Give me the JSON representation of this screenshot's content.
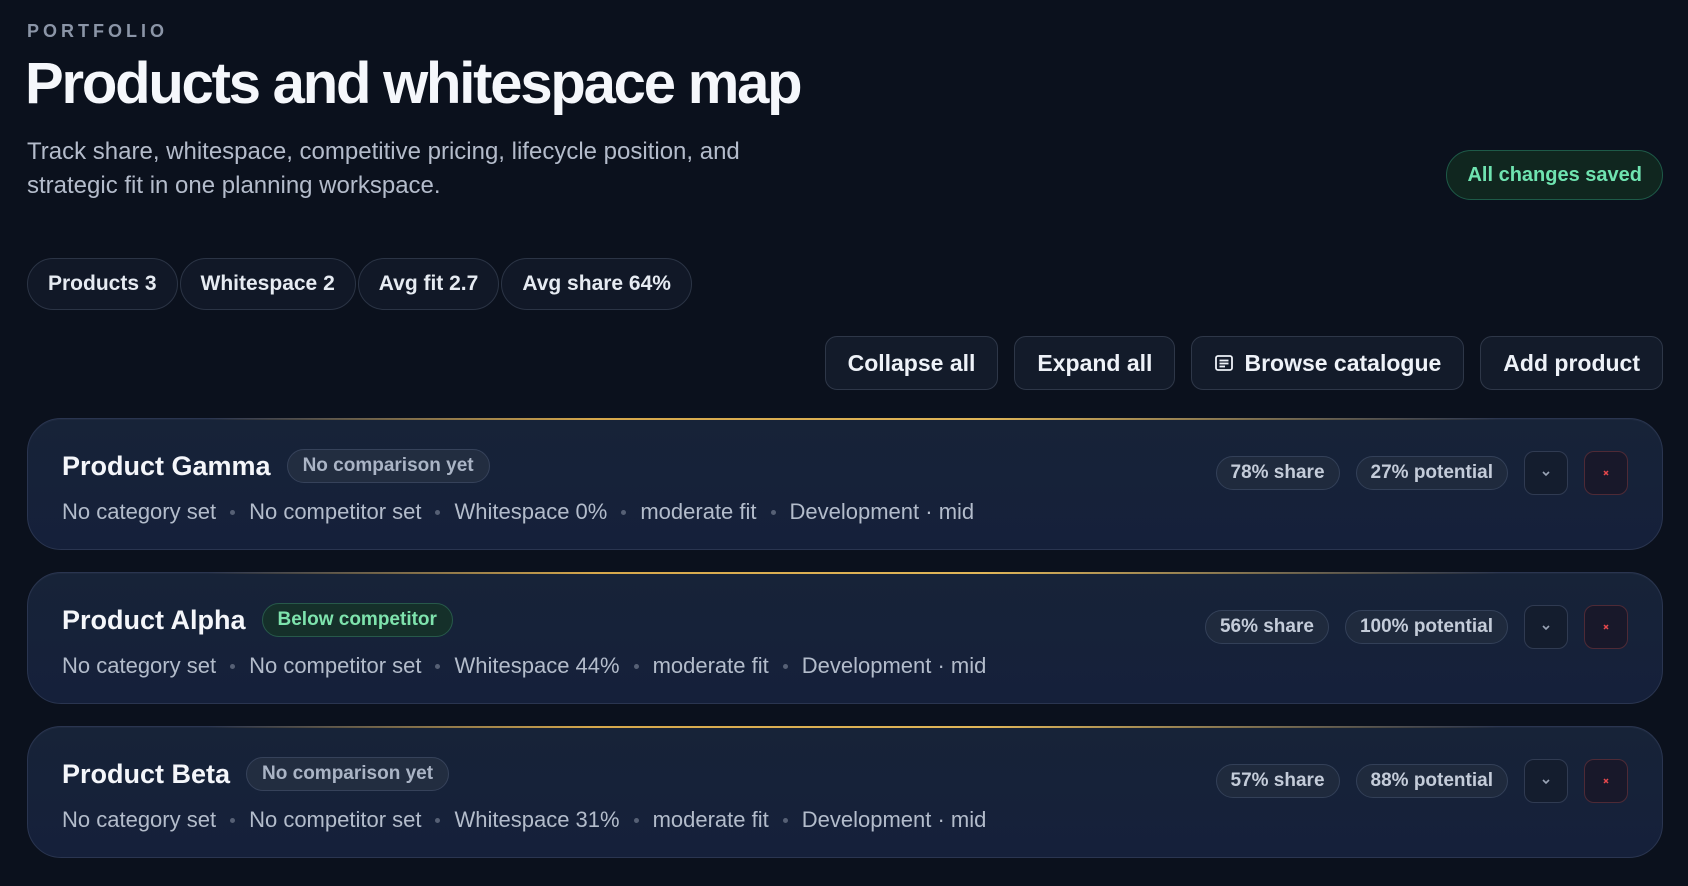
{
  "header": {
    "eyebrow": "PORTFOLIO",
    "title": "Products and whitespace map",
    "subtitle": "Track share, whitespace, competitive pricing, lifecycle position, and strategic fit in one planning workspace.",
    "saved_status": "All changes saved"
  },
  "stats": [
    {
      "label": "Products 3"
    },
    {
      "label": "Whitespace 2"
    },
    {
      "label": "Avg fit 2.7"
    },
    {
      "label": "Avg share 64%"
    }
  ],
  "toolbar": {
    "collapse_label": "Collapse all",
    "expand_label": "Expand all",
    "browse_label": "Browse catalogue",
    "add_label": "Add product"
  },
  "products": [
    {
      "name": "Product Gamma",
      "comparison": "No comparison yet",
      "category": "No category set",
      "competitor": "No competitor set",
      "whitespace": "Whitespace 0%",
      "fit": "moderate fit",
      "lifecycle": "Development · mid",
      "share": "78% share",
      "potential": "27% potential"
    },
    {
      "name": "Product Alpha",
      "comparison": "Below competitor",
      "category": "No category set",
      "competitor": "No competitor set",
      "whitespace": "Whitespace 44%",
      "fit": "moderate fit",
      "lifecycle": "Development · mid",
      "share": "56% share",
      "potential": "100% potential"
    },
    {
      "name": "Product Beta",
      "comparison": "No comparison yet",
      "category": "No category set",
      "competitor": "No competitor set",
      "whitespace": "Whitespace 31%",
      "fit": "moderate fit",
      "lifecycle": "Development · mid",
      "share": "57% share",
      "potential": "88% potential"
    }
  ],
  "icons": {
    "browse": "list-document-icon",
    "expand_row": "chevron-down-icon",
    "remove_row": "close-icon"
  },
  "colors": {
    "background": "#0b111d",
    "accent_gold": "#d6a84c",
    "saved_green": "#6fe3b0",
    "danger": "#e5484d"
  }
}
